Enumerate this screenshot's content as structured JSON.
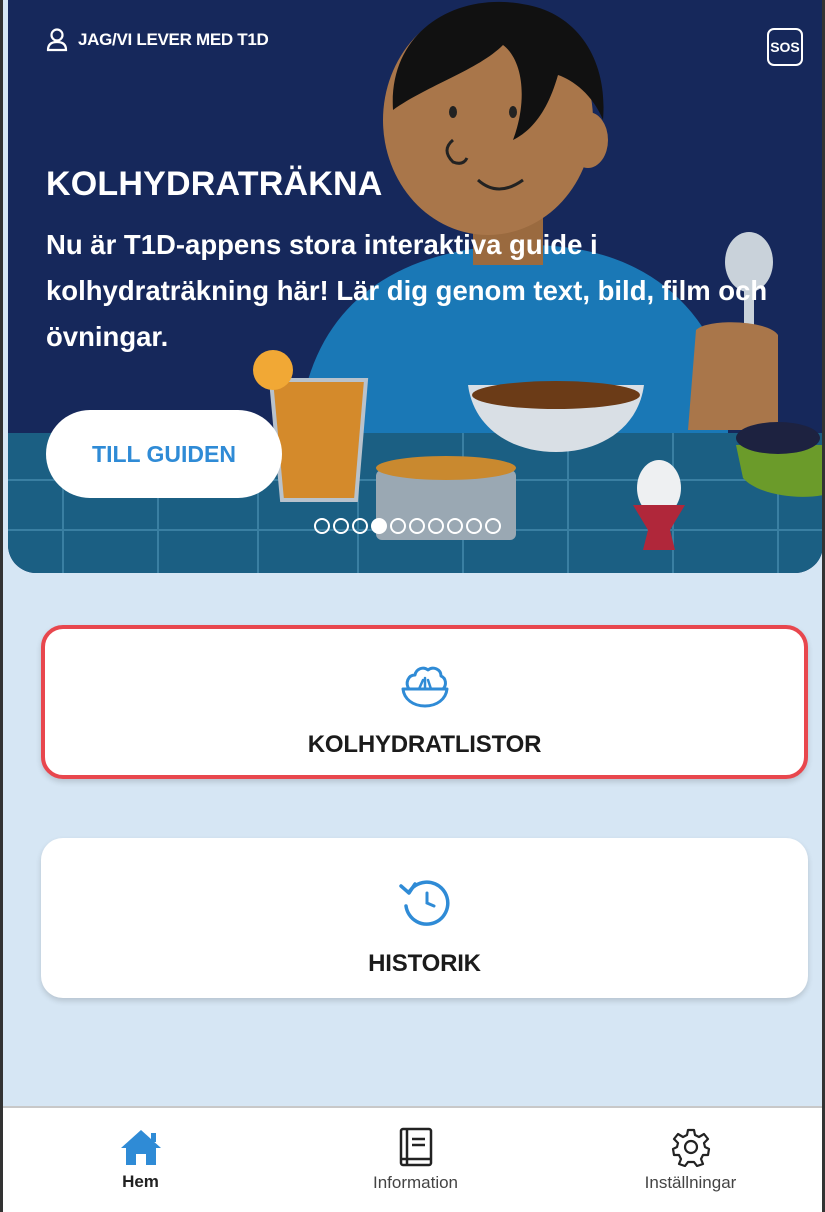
{
  "header": {
    "profile_label": "JAG/VI LEVER MED T1D",
    "sos_label": "SOS"
  },
  "hero": {
    "title": "KOLHYDRATRÄKNA",
    "body": "Nu är T1D-appens stora interaktiva guide i kolhydraträkning här! Lär dig genom text, bild, film och övningar.",
    "button_label": "TILL GUIDEN",
    "carousel": {
      "total": 10,
      "active_index": 3
    }
  },
  "cards": [
    {
      "label": "KOLHYDRATLISTOR",
      "icon": "salad-bowl-icon",
      "selected": true
    },
    {
      "label": "HISTORIK",
      "icon": "history-clock-icon",
      "selected": false
    }
  ],
  "nav": {
    "items": [
      {
        "label": "Hem",
        "icon": "home-icon",
        "active": true
      },
      {
        "label": "Information",
        "icon": "book-icon",
        "active": false
      },
      {
        "label": "Inställningar",
        "icon": "gear-icon",
        "active": false
      }
    ]
  },
  "colors": {
    "hero_bg": "#16285b",
    "accent_blue": "#2f8bd6",
    "selected_border": "#e8474e",
    "page_bg": "#d6e6f4"
  }
}
